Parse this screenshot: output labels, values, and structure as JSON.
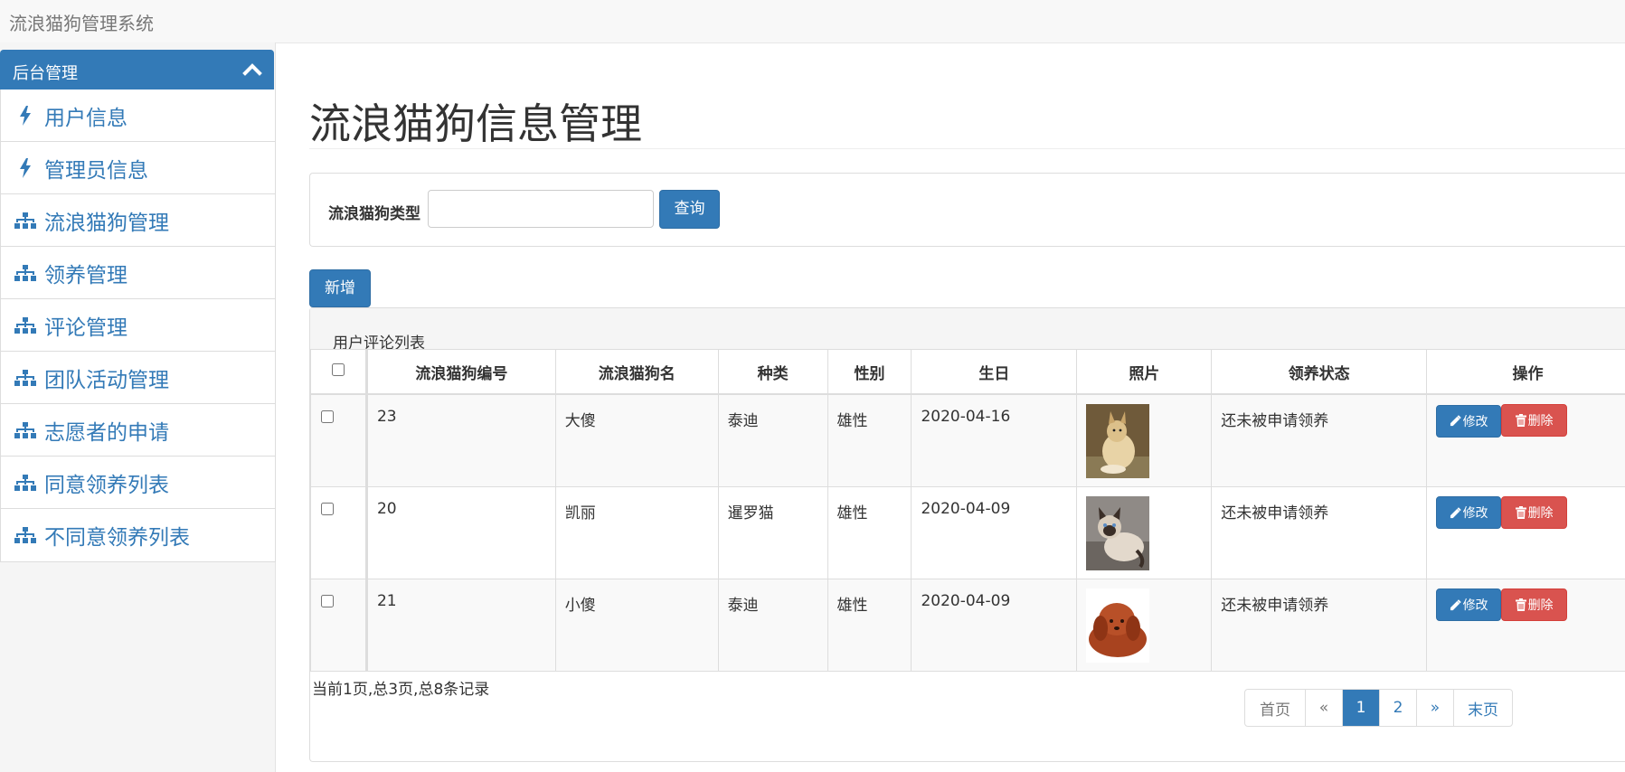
{
  "brand": "流浪猫狗管理系统",
  "sidebar": {
    "panel_title": "后台管理",
    "items": [
      {
        "label": "用户信息",
        "icon": "flash-icon"
      },
      {
        "label": "管理员信息",
        "icon": "flash-icon"
      },
      {
        "label": "流浪猫狗管理",
        "icon": "sitemap-icon"
      },
      {
        "label": "领养管理",
        "icon": "sitemap-icon"
      },
      {
        "label": "评论管理",
        "icon": "sitemap-icon"
      },
      {
        "label": "团队活动管理",
        "icon": "sitemap-icon"
      },
      {
        "label": "志愿者的申请",
        "icon": "sitemap-icon"
      },
      {
        "label": "同意领养列表",
        "icon": "sitemap-icon"
      },
      {
        "label": "不同意领养列表",
        "icon": "sitemap-icon"
      }
    ]
  },
  "main": {
    "page_title": "流浪猫狗信息管理",
    "search": {
      "label": "流浪猫狗类型",
      "value": "",
      "button": "查询"
    },
    "add_button": "新增",
    "list_caption": "用户评论列表",
    "table": {
      "headers": [
        "流浪猫狗编号",
        "流浪猫狗名",
        "种类",
        "性别",
        "生日",
        "照片",
        "领养状态",
        "操作"
      ],
      "rows": [
        {
          "id": "23",
          "name": "大傻",
          "kind": "泰迪",
          "sex": "雄性",
          "birthday": "2020-04-16",
          "status": "还未被申请领养",
          "photo": "dog-photo"
        },
        {
          "id": "20",
          "name": "凯丽",
          "kind": "暹罗猫",
          "sex": "雄性",
          "birthday": "2020-04-09",
          "status": "还未被申请领养",
          "photo": "cat-photo"
        },
        {
          "id": "21",
          "name": "小傻",
          "kind": "泰迪",
          "sex": "雄性",
          "birthday": "2020-04-09",
          "status": "还未被申请领养",
          "photo": "dog-photo"
        }
      ],
      "edit_label": "修改",
      "delete_label": "删除"
    },
    "page_info": "当前1页,总3页,总8条记录",
    "pagination": [
      "首页",
      "«",
      "1",
      "2",
      "»",
      "末页"
    ],
    "current_page": "1"
  },
  "colors": {
    "primary": "#337ab7",
    "danger": "#d9534f"
  }
}
